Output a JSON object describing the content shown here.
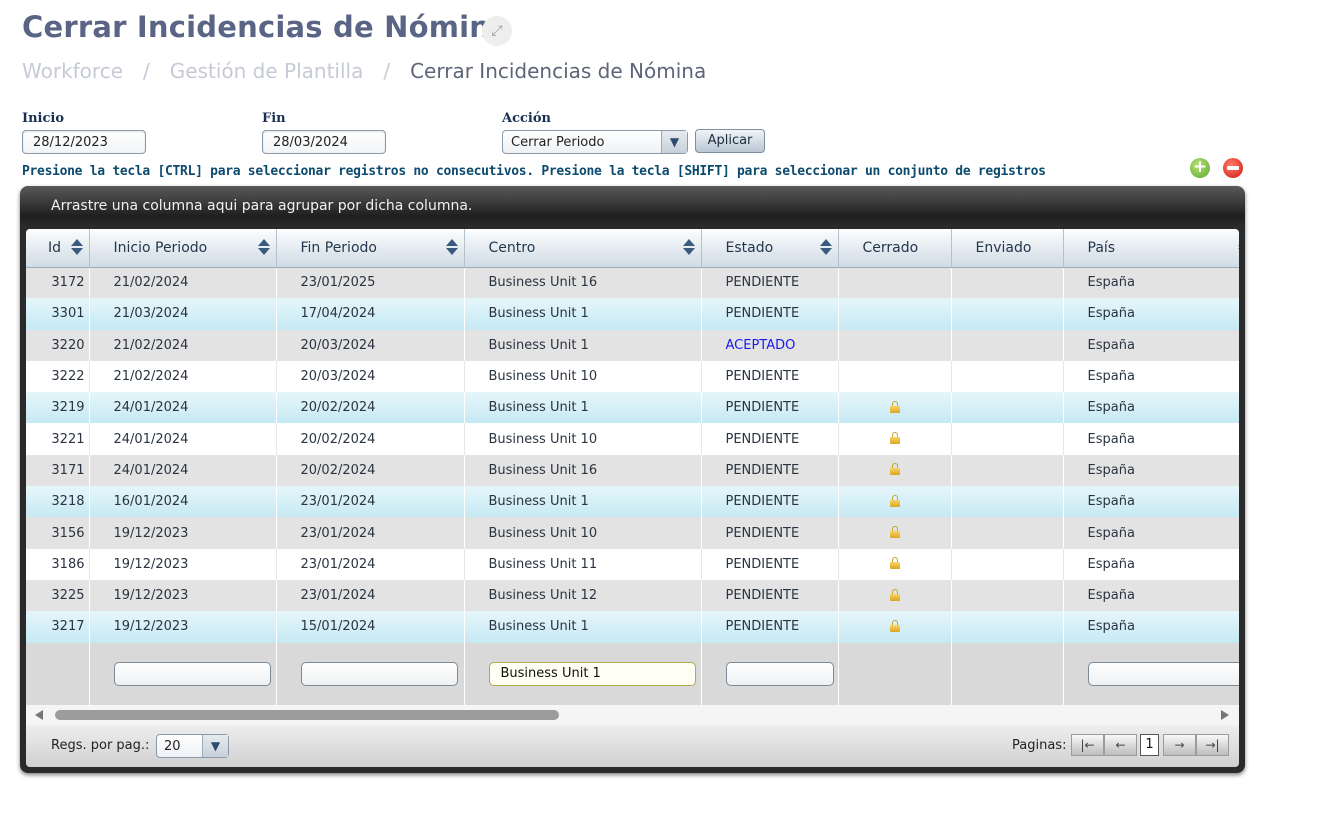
{
  "page": {
    "title": "Cerrar Incidencias de Nómina",
    "breadcrumb": [
      "Workforce",
      "Gestión de Plantilla",
      "Cerrar Incidencias de Nómina"
    ],
    "breadcrumb_separator": "/"
  },
  "filters": {
    "inicio_label": "Inicio",
    "inicio_value": "28/12/2023",
    "fin_label": "Fin",
    "fin_value": "28/03/2024",
    "accion_label": "Acción",
    "accion_value": "Cerrar Periodo",
    "apply_label": "Aplicar"
  },
  "hint": "Presione la tecla [CTRL] para seleccionar registros no consecutivos. Presione la tecla [SHIFT] para seleccionar un conjunto de registros",
  "grid": {
    "group_hint": "Arrastre una columna aqui para agrupar por dicha columna.",
    "columns": [
      "Id",
      "Inicio Periodo",
      "Fin Periodo",
      "Centro",
      "Estado",
      "Cerrado",
      "Enviado",
      "País"
    ],
    "rows": [
      {
        "id": "3172",
        "inicio": "21/02/2024",
        "fin": "23/01/2025",
        "centro": "Business Unit 16",
        "estado": "PENDIENTE",
        "cerrado": false,
        "enviado": "",
        "pais": "España",
        "style": "gray"
      },
      {
        "id": "3301",
        "inicio": "21/03/2024",
        "fin": "17/04/2024",
        "centro": "Business Unit 1",
        "estado": "PENDIENTE",
        "cerrado": false,
        "enviado": "",
        "pais": "España",
        "style": "blue"
      },
      {
        "id": "3220",
        "inicio": "21/02/2024",
        "fin": "20/03/2024",
        "centro": "Business Unit 1",
        "estado": "ACEPTADO",
        "cerrado": false,
        "enviado": "",
        "pais": "España",
        "style": "gray"
      },
      {
        "id": "3222",
        "inicio": "21/02/2024",
        "fin": "20/03/2024",
        "centro": "Business Unit 10",
        "estado": "PENDIENTE",
        "cerrado": false,
        "enviado": "",
        "pais": "España",
        "style": "white"
      },
      {
        "id": "3219",
        "inicio": "24/01/2024",
        "fin": "20/02/2024",
        "centro": "Business Unit 1",
        "estado": "PENDIENTE",
        "cerrado": true,
        "enviado": "",
        "pais": "España",
        "style": "blue"
      },
      {
        "id": "3221",
        "inicio": "24/01/2024",
        "fin": "20/02/2024",
        "centro": "Business Unit 10",
        "estado": "PENDIENTE",
        "cerrado": true,
        "enviado": "",
        "pais": "España",
        "style": "white"
      },
      {
        "id": "3171",
        "inicio": "24/01/2024",
        "fin": "20/02/2024",
        "centro": "Business Unit 16",
        "estado": "PENDIENTE",
        "cerrado": true,
        "enviado": "",
        "pais": "España",
        "style": "gray"
      },
      {
        "id": "3218",
        "inicio": "16/01/2024",
        "fin": "23/01/2024",
        "centro": "Business Unit 1",
        "estado": "PENDIENTE",
        "cerrado": true,
        "enviado": "",
        "pais": "España",
        "style": "blue"
      },
      {
        "id": "3156",
        "inicio": "19/12/2023",
        "fin": "23/01/2024",
        "centro": "Business Unit 10",
        "estado": "PENDIENTE",
        "cerrado": true,
        "enviado": "",
        "pais": "España",
        "style": "gray"
      },
      {
        "id": "3186",
        "inicio": "19/12/2023",
        "fin": "23/01/2024",
        "centro": "Business Unit 11",
        "estado": "PENDIENTE",
        "cerrado": true,
        "enviado": "",
        "pais": "España",
        "style": "white"
      },
      {
        "id": "3225",
        "inicio": "19/12/2023",
        "fin": "23/01/2024",
        "centro": "Business Unit 12",
        "estado": "PENDIENTE",
        "cerrado": true,
        "enviado": "",
        "pais": "España",
        "style": "gray"
      },
      {
        "id": "3217",
        "inicio": "19/12/2023",
        "fin": "15/01/2024",
        "centro": "Business Unit 1",
        "estado": "PENDIENTE",
        "cerrado": true,
        "enviado": "",
        "pais": "España",
        "style": "blue"
      }
    ],
    "filter_values": {
      "inicio": "",
      "fin": "",
      "centro": "Business Unit 1",
      "estado": "",
      "pais": ""
    }
  },
  "pager": {
    "per_page_label": "Regs. por pag.:",
    "per_page_value": "20",
    "pages_label": "Paginas:",
    "current_page": "1"
  },
  "colors": {
    "title": "#5a6586",
    "accepted_state": "#1a1aee",
    "hint_text": "#0c4a6e",
    "row_selected": "#c6e9f3"
  }
}
